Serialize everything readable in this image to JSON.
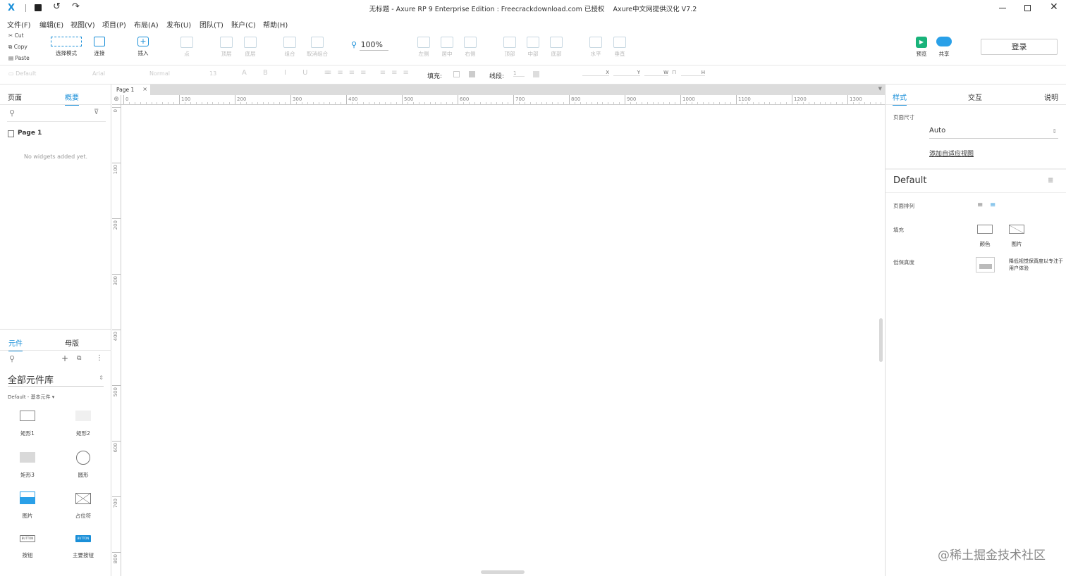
{
  "titlebar": {
    "title": "无标题 - Axure RP 9 Enterprise Edition : Freecrackdownload.com 已授权    Axure中文网提供汉化 V7.2"
  },
  "menu": [
    "文件(F)",
    "编辑(E)",
    "视图(V)",
    "项目(P)",
    "布局(A)",
    "发布(U)",
    "团队(T)",
    "账户(C)",
    "帮助(H)"
  ],
  "clipboard": {
    "cut": "Cut",
    "copy": "Copy",
    "paste": "Paste"
  },
  "toolbar": {
    "select_mode": "选择模式",
    "connect": "连接",
    "insert": "插入",
    "point": "点",
    "top": "顶层",
    "bottom": "底层",
    "group": "组合",
    "ungroup": "取消组合",
    "zoom": "100%",
    "align_left": "左侧",
    "align_center": "居中",
    "align_right": "右侧",
    "align_top": "顶部",
    "align_middle": "中部",
    "align_bottom": "底部",
    "dist_h": "水平",
    "dist_v": "垂直",
    "preview": "预览",
    "share": "共享",
    "login": "登录"
  },
  "format": {
    "style": "Default",
    "font": "Arial",
    "weight": "Normal",
    "size": "13",
    "fill_label": "填充:",
    "stroke_label": "线段:",
    "stroke_value": "1",
    "x": "X",
    "y": "Y",
    "w": "W",
    "h": "H"
  },
  "left_top": {
    "tab_pages": "页面",
    "tab_outline": "概要",
    "page_item": "Page 1",
    "empty": "No widgets added yet."
  },
  "left_bottom": {
    "tab_widgets": "元件",
    "tab_masters": "母版",
    "library": "全部元件库",
    "sub": "Default - 基本元件 ▾",
    "widgets": [
      "矩形1",
      "矩形2",
      "矩形3",
      "圆形",
      "图片",
      "占位符",
      "按钮",
      "主要按钮"
    ],
    "btn_text": "BUTTON"
  },
  "canvas": {
    "tab": "Page 1",
    "hticks": [
      "0",
      "100",
      "200",
      "300",
      "400",
      "500",
      "600",
      "700",
      "800",
      "900",
      "1000",
      "1100",
      "1200",
      "1300"
    ],
    "vticks": [
      "0",
      "100",
      "200",
      "300",
      "400",
      "500",
      "600",
      "700",
      "800"
    ]
  },
  "right": {
    "tab_style": "样式",
    "tab_interact": "交互",
    "tab_notes": "说明",
    "page_size_label": "页面尺寸",
    "page_size": "Auto",
    "adaptive": "添加自适应视图",
    "style_name": "Default",
    "align_label": "页面排列",
    "fill_label": "填充",
    "fill_color": "颜色",
    "fill_image": "图片",
    "lowfi_label": "低保真度",
    "lowfi_desc": "降低视觉保真度以专注于用户体验"
  },
  "watermark": "@稀土掘金技术社区",
  "colors": {
    "accent": "#1a8fd8",
    "brand_green": "#19b37a",
    "share_blue": "#2aa0e8"
  }
}
